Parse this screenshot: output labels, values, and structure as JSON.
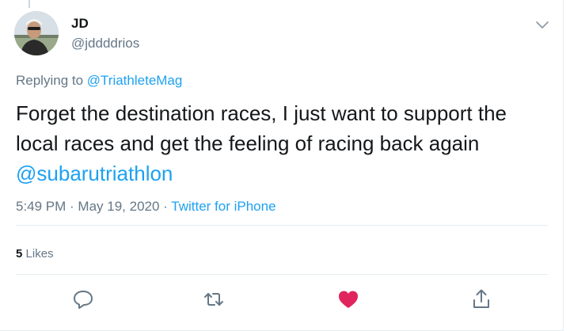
{
  "author": {
    "name": "JD",
    "handle": "@jddddrios"
  },
  "reply": {
    "prefix": "Replying to ",
    "target": "@TriathleteMag"
  },
  "tweet": {
    "line1": "Forget the destination races, I just want to support the",
    "line2": "local races and get the feeling of racing back again",
    "mention": "@subarutriathlon"
  },
  "meta": {
    "time": "5:49 PM",
    "sep1": " · ",
    "date": "May 19, 2020",
    "sep2": " · ",
    "source": "Twitter for iPhone"
  },
  "stats": {
    "likes_count": "5",
    "likes_label": "Likes"
  },
  "icons": {
    "caret": "chevron-down-icon",
    "reply": "reply-icon",
    "retweet": "retweet-icon",
    "like": "heart-icon",
    "share": "share-icon"
  },
  "colors": {
    "link": "#1da1f2",
    "secondary": "#657786",
    "like": "#e0245e",
    "text": "#14171a"
  }
}
